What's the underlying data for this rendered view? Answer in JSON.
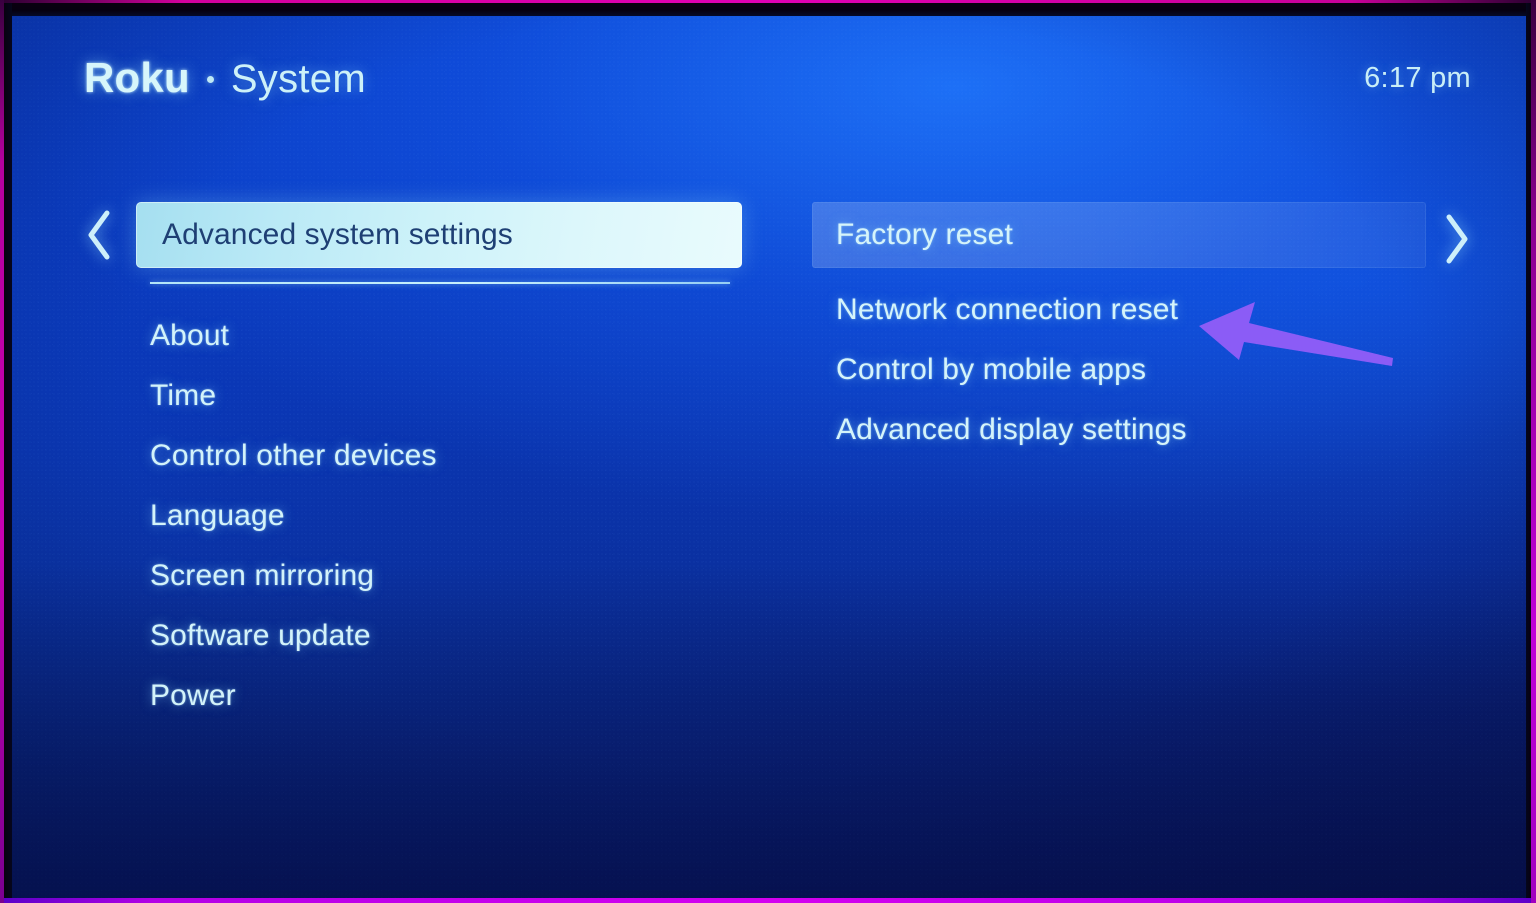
{
  "header": {
    "brand": "Roku",
    "separator_icon": "dot-separator-icon",
    "section": "System",
    "clock": "6:17 pm"
  },
  "navigation": {
    "left_chevron_icon": "chevron-left-icon",
    "right_chevron_icon": "chevron-right-icon"
  },
  "left_column": {
    "selected_item": "Advanced system settings",
    "items": [
      {
        "label": "About"
      },
      {
        "label": "Time"
      },
      {
        "label": "Control other devices"
      },
      {
        "label": "Language"
      },
      {
        "label": "Screen mirroring"
      },
      {
        "label": "Software update"
      },
      {
        "label": "Power"
      }
    ]
  },
  "right_column": {
    "highlighted_item": "Factory reset",
    "items": [
      {
        "label": "Network connection reset"
      },
      {
        "label": "Control by mobile apps"
      },
      {
        "label": "Advanced display settings"
      }
    ]
  },
  "annotation": {
    "type": "arrow",
    "points_to": "Network connection reset",
    "direction": "left",
    "color": "#8b5cf6"
  },
  "colors": {
    "screen_bright_blue": "#1560ee",
    "screen_deep_blue": "#0a2080",
    "selected_pill_light": "#e9fbfd",
    "selected_pill_cyan": "#a5dff0",
    "selected_text": "#1e3f74",
    "menu_text": "#d3f3fa",
    "frame_magenta": "#c800b4",
    "annotation_purple": "#8b5cf6"
  }
}
